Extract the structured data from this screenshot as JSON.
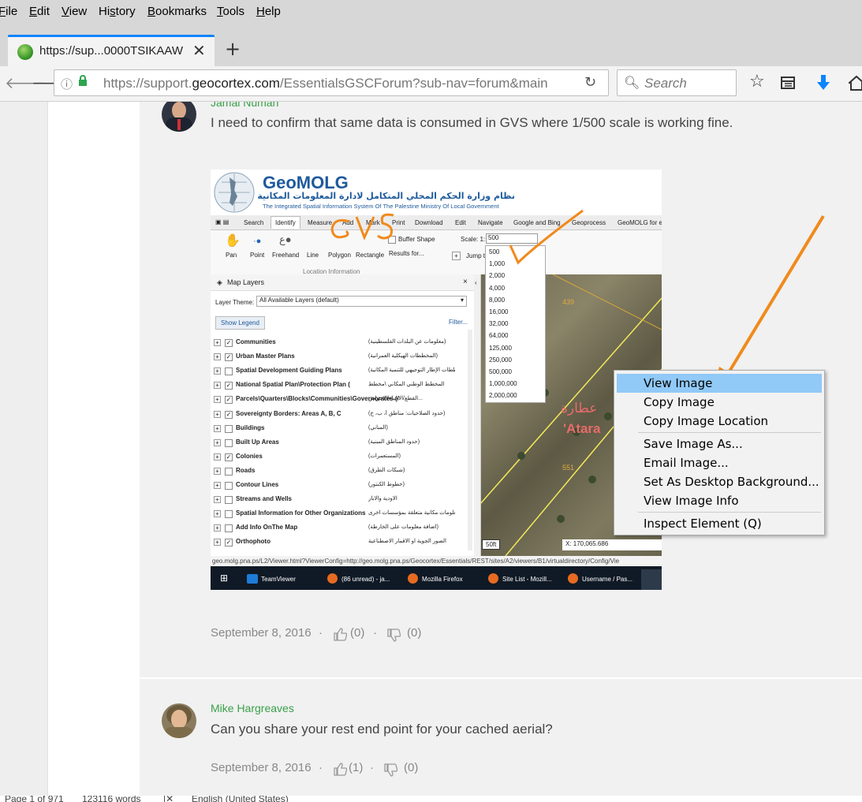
{
  "menu": [
    {
      "label": "File",
      "u": "F"
    },
    {
      "label": "Edit",
      "u": "E"
    },
    {
      "label": "View",
      "u": "V"
    },
    {
      "label": "History",
      "u": "s"
    },
    {
      "label": "Bookmarks",
      "u": "B"
    },
    {
      "label": "Tools",
      "u": "T"
    },
    {
      "label": "Help",
      "u": "H"
    }
  ],
  "tab": {
    "title": "https://sup...0000TSIKAAW"
  },
  "url": {
    "prefix": "https://support.",
    "domain": "geocortex.com",
    "path": "/EssentialsGSCForum?sub-nav=forum&main"
  },
  "search": {
    "placeholder": "Search"
  },
  "post1": {
    "author": "Jamal Numan",
    "text": "I need to confirm that same data is consumed in GVS where 1/500 scale is working fine.",
    "date": "September 8, 2016",
    "likes": "(0)",
    "dislikes": "(0)",
    "dot": "·"
  },
  "post2": {
    "author": "Mike Hargreaves",
    "text": "Can you share your rest end point for your cached aerial?",
    "date": "September 8, 2016",
    "likes": "(1)",
    "dislikes": "(0)",
    "dot": "·"
  },
  "screenshot": {
    "brand": "GeoMOLG",
    "arabic_title": "نظام وزارة الحكم المحلي المتكامل لادارة المعلومات المكانية",
    "english_title": "The Integrated Spatial Information System Of The Palestine Ministry Of Local Government",
    "tabs": [
      "Search",
      "Identify",
      "Measure",
      "Add",
      "Mark",
      "Print",
      "Download",
      "Edit",
      "Navigate",
      "Google and Bing",
      "Geoprocess",
      "GeoMOLG for e"
    ],
    "tools": [
      "Pan",
      "Point",
      "Freehand",
      "Line",
      "Polygon",
      "Rectangle",
      "Results for..."
    ],
    "buffer": "Buffer Shape",
    "scale_label": "Scale: 1:",
    "scale_value": "500",
    "jump": "Jump t",
    "loc_info": "Location Information",
    "scales": [
      "500",
      "1,000",
      "2,000",
      "4,000",
      "8,000",
      "16,000",
      "32,000",
      "64,000",
      "125,000",
      "250,000",
      "500,000",
      "1,000,000",
      "2,000,000"
    ],
    "panel_title": "Map Layers",
    "layer_theme_label": "Layer Theme:",
    "layer_theme": "All Available Layers (default)",
    "show_legend": "Show Legend",
    "filter": "Filter...",
    "layers": [
      {
        "name": "Communities",
        "ar": "(معلومات عن البلدات الفلسطينية)",
        "checked": true
      },
      {
        "name": "Urban Master Plans",
        "ar": "(المخططات الهيكلية العمرانية)",
        "checked": true
      },
      {
        "name": "Spatial Development Guiding Plans",
        "ar": "(مخططات الإطار التوجيهي للتنمية المكانية)",
        "checked": false
      },
      {
        "name": "National Spatial Plan\\Protection Plan (",
        "ar": "المخطط الوطني المكاني \\مخطط",
        "checked": true
      },
      {
        "name": "Parcels\\Quarters\\Blocks\\Communities\\Governorates (/",
        "ar": "القطع/الاحياء/الاحواض...",
        "checked": true
      },
      {
        "name": "Sovereignty Borders: Areas A, B, C",
        "ar": "(حدود الصلاحيات: مناطق أ، ب، ج)",
        "checked": true
      },
      {
        "name": "Buildings",
        "ar": "(المباني)",
        "checked": false
      },
      {
        "name": "Built Up Areas",
        "ar": "(حدود المناطق المبنية)",
        "checked": false
      },
      {
        "name": "Colonies",
        "ar": "(المستعمرات)",
        "checked": true
      },
      {
        "name": "Roads",
        "ar": "(شبكات الطرق)",
        "checked": false
      },
      {
        "name": "Contour Lines",
        "ar": "(خطوط الكنتور)",
        "checked": false
      },
      {
        "name": "Streams and Wells",
        "ar": "الاودية والابار",
        "checked": false
      },
      {
        "name": "Spatial Information for Other Organizations",
        "ar": "معلومات مكانية متعلقة بمؤسسات اخرى",
        "checked": false
      },
      {
        "name": "Add Info OnThe Map",
        "ar": "(اضافة معلومات على الخارطة)",
        "checked": false
      },
      {
        "name": "Orthophoto",
        "ar": "الصور الجوية او الاقمار الاصطناعية",
        "checked": true
      }
    ],
    "map_labels": [
      "439",
      "551"
    ],
    "map_arabic": "عطارة",
    "map_latin": "'Atara",
    "scalebar": "50ft",
    "coord_x": "X:  170,065.686",
    "status_url": "geo.molg.pna.ps/L2/Viewer.html?ViewerConfig=http://geo.molg.pna.ps/Geocortex/Essentials/REST/sites/A2/viewers/B1/virtualdirectory/Config/Vie",
    "taskbar": [
      "TeamViewer",
      "(86 unread) - ja...",
      "Mozilla Firefox",
      "Site List - Mozill...",
      "Username / Pas..."
    ],
    "annotation_word": "GVS"
  },
  "context_menu": {
    "items": [
      "View Image",
      "Copy Image",
      "Copy Image Location",
      "Save Image As...",
      "Email Image...",
      "Set As Desktop Background...",
      "View Image Info",
      "Inspect Element (Q)"
    ]
  },
  "statusbar": {
    "page": "Page 1 of 971",
    "words": "123116 words",
    "lang": "English (United States)"
  },
  "colors": {
    "accent": "#0a84ff",
    "author": "#3aa04a",
    "highlight": "#91c9f7",
    "arrow": "#f08a1c"
  }
}
